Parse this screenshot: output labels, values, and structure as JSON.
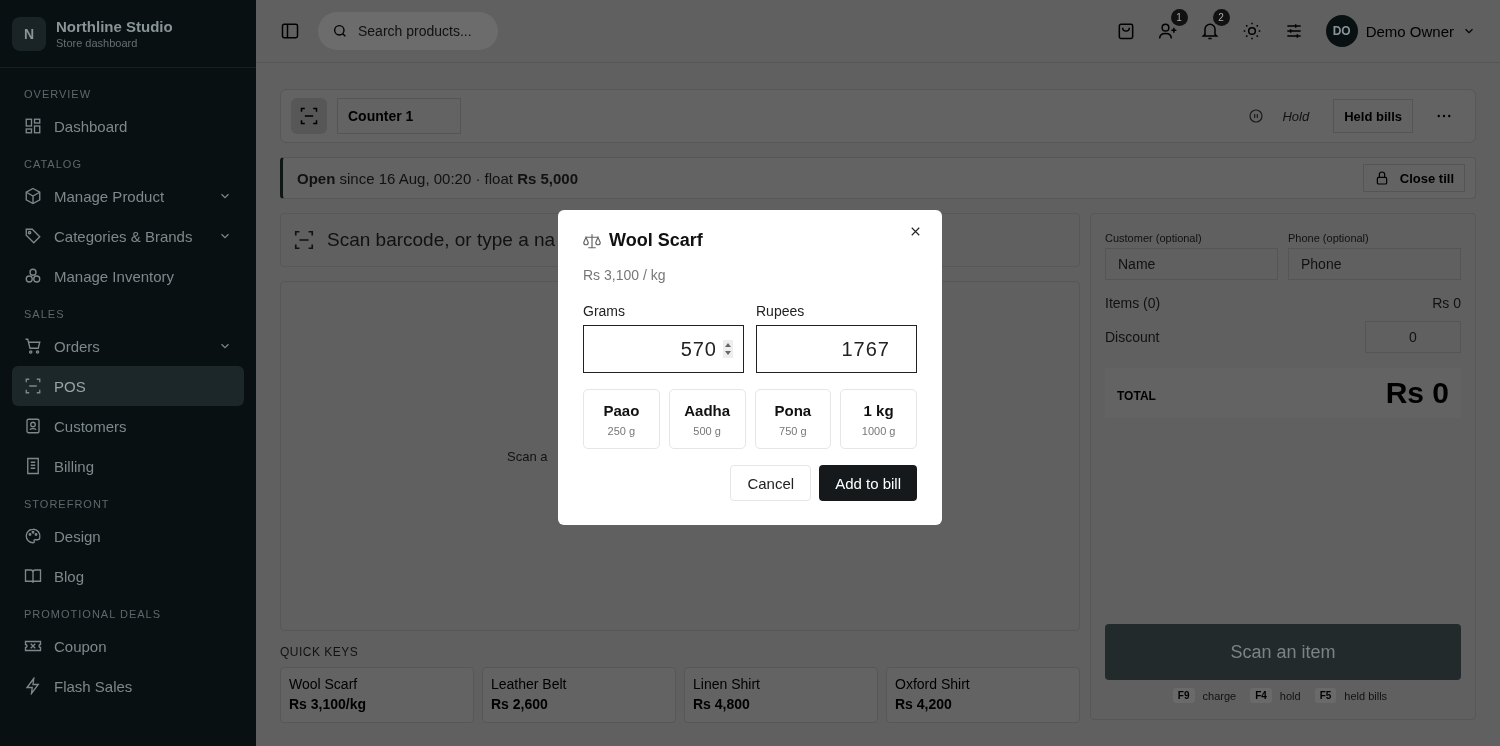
{
  "brand": {
    "initial": "N",
    "name": "Northline Studio",
    "subtitle": "Store dashboard"
  },
  "sidebar": {
    "sections": [
      {
        "heading": "OVERVIEW",
        "items": [
          {
            "label": "Dashboard",
            "kind": "grid",
            "chevron": false,
            "selected": false
          }
        ]
      },
      {
        "heading": "CATALOG",
        "items": [
          {
            "label": "Manage Product",
            "kind": "box",
            "chevron": true,
            "selected": false
          },
          {
            "label": "Categories & Brands",
            "kind": "tag",
            "chevron": true,
            "selected": false
          },
          {
            "label": "Manage Inventory",
            "kind": "boxes",
            "chevron": false,
            "selected": false
          }
        ]
      },
      {
        "heading": "SALES",
        "items": [
          {
            "label": "Orders",
            "kind": "cart",
            "chevron": true,
            "selected": false
          },
          {
            "label": "POS",
            "kind": "scan",
            "chevron": false,
            "selected": true
          },
          {
            "label": "Customers",
            "kind": "contact",
            "chevron": false,
            "selected": false
          },
          {
            "label": "Billing",
            "kind": "receipt",
            "chevron": false,
            "selected": false
          }
        ]
      },
      {
        "heading": "STOREFRONT",
        "items": [
          {
            "label": "Design",
            "kind": "palette",
            "chevron": false,
            "selected": false
          },
          {
            "label": "Blog",
            "kind": "book",
            "chevron": false,
            "selected": false
          }
        ]
      },
      {
        "heading": "PROMOTIONAL DEALS",
        "items": [
          {
            "label": "Coupon",
            "kind": "ticket",
            "chevron": false,
            "selected": false
          },
          {
            "label": "Flash Sales",
            "kind": "bolt",
            "chevron": false,
            "selected": false
          }
        ]
      }
    ]
  },
  "topbar": {
    "search_placeholder": "Search products...",
    "customer_badge": "1",
    "notification_badge": "2",
    "user_initials": "DO",
    "user_name": "Demo Owner"
  },
  "toolbar": {
    "counter": "Counter 1",
    "hold": "Hold",
    "held_bills": "Held bills"
  },
  "till": {
    "status": "**Open** since 16 Aug, 00:20 · float **Rs 5,000**",
    "close": "Close till"
  },
  "scan": {
    "placeholder": "Scan barcode, or type a na",
    "empty_hint": "Scan a"
  },
  "quick_keys": {
    "heading": "QUICK KEYS",
    "items": [
      {
        "name": "Wool Scarf",
        "price": "Rs 3,100/kg"
      },
      {
        "name": "Leather Belt",
        "price": "Rs 2,600"
      },
      {
        "name": "Linen Shirt",
        "price": "Rs 4,800"
      },
      {
        "name": "Oxford Shirt",
        "price": "Rs 4,200"
      }
    ]
  },
  "cart": {
    "customer_label": "Customer (optional)",
    "customer_placeholder": "Name",
    "phone_label": "Phone (optional)",
    "phone_placeholder": "Phone",
    "items_label": "Items (0)",
    "items_value": "Rs 0",
    "discount_label": "Discount",
    "discount_value": "0",
    "total_label": "TOTAL",
    "total_value": "Rs 0",
    "charge": {
      "label": "Scan an item",
      "disabled": true
    },
    "shortcuts": [
      {
        "key": "F9",
        "label": "charge"
      },
      {
        "key": "F4",
        "label": "hold"
      },
      {
        "key": "F5",
        "label": "held bills"
      }
    ]
  },
  "dialog": {
    "title": "Wool Scarf",
    "price": "Rs 3,100 / kg",
    "grams_label": "Grams",
    "grams_value": "570",
    "rupees_label": "Rupees",
    "rupees_value": "1767",
    "presets": [
      {
        "name": "Paao",
        "weight": "250 g"
      },
      {
        "name": "Aadha",
        "weight": "500 g"
      },
      {
        "name": "Pona",
        "weight": "750 g"
      },
      {
        "name": "1 kg",
        "weight": "1000 g"
      }
    ],
    "cancel": "Cancel",
    "add": "Add to bill"
  }
}
